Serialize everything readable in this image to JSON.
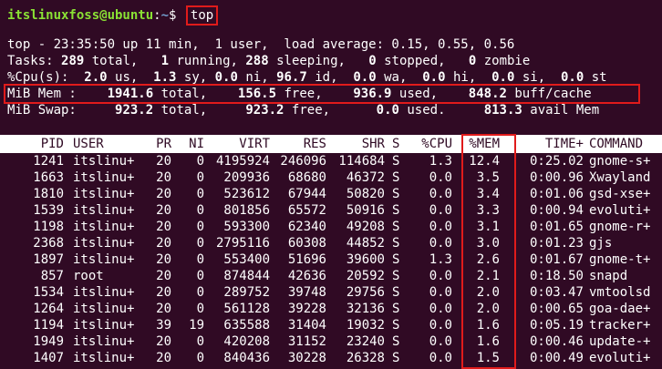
{
  "prompt": {
    "user_host": "itslinuxfoss@ubuntu",
    "sep": ":",
    "path": "~",
    "symbol": "$",
    "command": "top"
  },
  "summary": {
    "line1": "top - 23:35:50 up 11 min,  1 user,  load average: 0.15, 0.55, 0.56",
    "tasks": {
      "label": "Tasks:",
      "total": "289",
      "total_lbl": " total,",
      "running": "1",
      "running_lbl": " running,",
      "sleeping": "288",
      "sleeping_lbl": " sleeping,",
      "stopped": "0",
      "stopped_lbl": " stopped,",
      "zombie": "0",
      "zombie_lbl": " zombie"
    },
    "cpu": {
      "label": "%Cpu(s):",
      "us": "2.0",
      "us_lbl": " us,",
      "sy": "1.3",
      "sy_lbl": " sy,",
      "ni": "0.0",
      "ni_lbl": " ni,",
      "id": "96.7",
      "id_lbl": " id,",
      "wa": "0.0",
      "wa_lbl": " wa,",
      "hi": "0.0",
      "hi_lbl": " hi,",
      "si": "0.0",
      "si_lbl": " si,",
      "st": "0.0",
      "st_lbl": " st"
    },
    "mem": {
      "label": "MiB Mem :",
      "total": "1941.6",
      "total_lbl": " total,",
      "free": "156.5",
      "free_lbl": " free,",
      "used": "936.9",
      "used_lbl": " used,",
      "buff": "848.2",
      "buff_lbl": " buff/cache"
    },
    "swap": {
      "label": "MiB Swap:",
      "total": "923.2",
      "total_lbl": " total,",
      "free": "923.2",
      "free_lbl": " free,",
      "used": "0.0",
      "used_lbl": " used.",
      "avail": "813.3",
      "avail_lbl": " avail Mem"
    }
  },
  "columns": [
    "PID",
    "USER",
    "PR",
    "NI",
    "VIRT",
    "RES",
    "SHR",
    "S",
    "%CPU",
    "%MEM",
    "TIME+",
    "COMMAND"
  ],
  "processes": [
    [
      "1241",
      "itslinu+",
      "20",
      "0",
      "4195924",
      "246096",
      "114684",
      "S",
      "1.3",
      "12.4",
      "0:25.02",
      "gnome-s+"
    ],
    [
      "1663",
      "itslinu+",
      "20",
      "0",
      "209936",
      "68680",
      "46372",
      "S",
      "0.0",
      "3.5",
      "0:00.96",
      "Xwayland"
    ],
    [
      "1810",
      "itslinu+",
      "20",
      "0",
      "523612",
      "67944",
      "50820",
      "S",
      "0.0",
      "3.4",
      "0:01.06",
      "gsd-xse+"
    ],
    [
      "1539",
      "itslinu+",
      "20",
      "0",
      "801856",
      "65572",
      "50916",
      "S",
      "0.0",
      "3.3",
      "0:00.94",
      "evoluti+"
    ],
    [
      "1198",
      "itslinu+",
      "20",
      "0",
      "593300",
      "62340",
      "49208",
      "S",
      "0.0",
      "3.1",
      "0:01.65",
      "gnome-r+"
    ],
    [
      "2368",
      "itslinu+",
      "20",
      "0",
      "2795116",
      "60308",
      "44852",
      "S",
      "0.0",
      "3.0",
      "0:01.23",
      "gjs"
    ],
    [
      "1897",
      "itslinu+",
      "20",
      "0",
      "553400",
      "51696",
      "39600",
      "S",
      "1.3",
      "2.6",
      "0:01.67",
      "gnome-t+"
    ],
    [
      "857",
      "root",
      "20",
      "0",
      "874844",
      "42636",
      "20592",
      "S",
      "0.0",
      "2.1",
      "0:18.50",
      "snapd"
    ],
    [
      "1534",
      "itslinu+",
      "20",
      "0",
      "289752",
      "39748",
      "29756",
      "S",
      "0.0",
      "2.0",
      "0:03.47",
      "vmtoolsd"
    ],
    [
      "1264",
      "itslinu+",
      "20",
      "0",
      "561128",
      "39228",
      "32136",
      "S",
      "0.0",
      "2.0",
      "0:00.65",
      "goa-dae+"
    ],
    [
      "1194",
      "itslinu+",
      "39",
      "19",
      "635588",
      "31404",
      "19032",
      "S",
      "0.0",
      "1.6",
      "0:05.19",
      "tracker+"
    ],
    [
      "1949",
      "itslinu+",
      "20",
      "0",
      "420208",
      "31152",
      "23240",
      "S",
      "0.0",
      "1.6",
      "0:00.46",
      "update-+"
    ],
    [
      "1407",
      "itslinu+",
      "20",
      "0",
      "840436",
      "30228",
      "26328",
      "S",
      "0.0",
      "1.5",
      "0:00.49",
      "evoluti+"
    ]
  ],
  "colors": {
    "background": "#300a24",
    "highlight": "#e01b1b",
    "prompt_user": "#8ae234",
    "prompt_path": "#729fcf"
  }
}
